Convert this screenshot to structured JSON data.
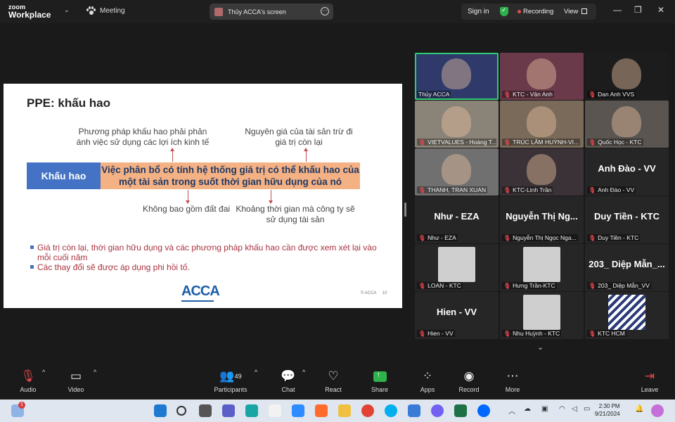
{
  "app": {
    "brand_top": "zoom",
    "brand_bottom": "Workplace",
    "meeting_label": "Meeting",
    "share_banner": "Thủy ACCA's screen",
    "signin": "Sign in",
    "recording": "Recording",
    "view": "View"
  },
  "slide": {
    "title": "PPE: khấu hao",
    "top_left": "Phương pháp khấu hao phải phản ánh việc sử dụng các lợi ích kinh tế",
    "top_right": "Nguyên giá của tài sản trừ đi giá trị còn lại",
    "term": "Khấu hao",
    "definition": "Việc phân bổ có tính hệ thống giá trị có thể khấu hao của một tài sản trong suốt thời gian hữu dụng của nó",
    "bottom_left": "Không bao gồm đất đai",
    "bottom_right": "Khoảng thời gian mà công ty sẽ sử dụng tài sản",
    "bullets": [
      "Giá trị còn lại, thời gian hữu dụng và các phương pháp khấu hao cần được xem xét lại vào mỗi cuối năm",
      "Các thay đổi sẽ được áp dụng phi hồi tố."
    ],
    "logo": "ACCA",
    "copyright": "© ACCA",
    "page": "10"
  },
  "gallery": [
    {
      "name": "Thủy ACCA",
      "big": "",
      "muted": false,
      "active": true,
      "bg": "#2f3a6b"
    },
    {
      "name": "KTC - Vân Anh",
      "big": "",
      "muted": true,
      "active": false,
      "bg": "#6b3a4a"
    },
    {
      "name": "Dan Anh VVS",
      "big": "",
      "muted": true,
      "active": false,
      "bg": "#1c1c1c"
    },
    {
      "name": "VIETVALUES - Hoàng T...",
      "big": "",
      "muted": true,
      "active": false,
      "bg": "#8a8478"
    },
    {
      "name": "TRÚC LÂM HUỲNH-VI...",
      "big": "",
      "muted": true,
      "active": false,
      "bg": "#7a6a5a"
    },
    {
      "name": "Quốc Học - KTC",
      "big": "",
      "muted": true,
      "active": false,
      "bg": "#5a5550"
    },
    {
      "name": "THANH, TRAN XUAN",
      "big": "",
      "muted": true,
      "active": false,
      "bg": "#707070"
    },
    {
      "name": "KTC-Linh Trần",
      "big": "",
      "muted": true,
      "active": false,
      "bg": "#3a3236"
    },
    {
      "name": "Anh Đào - VV",
      "big": "Anh Đào - VV",
      "muted": true,
      "active": false,
      "bg": "#262626"
    },
    {
      "name": "Như - EZA",
      "big": "Như - EZA",
      "muted": true,
      "active": false,
      "bg": "#262626"
    },
    {
      "name": "Nguyễn Thị Ngọc Nga...",
      "big": "Nguyễn Thị Ng...",
      "muted": true,
      "active": false,
      "bg": "#262626"
    },
    {
      "name": "Duy Tiền - KTC",
      "big": "Duy Tiền - KTC",
      "muted": true,
      "active": false,
      "bg": "#262626"
    },
    {
      "name": "LOAN - KTC",
      "big": "",
      "muted": true,
      "active": false,
      "bg": "#262626"
    },
    {
      "name": "Hưng Trần-KTC",
      "big": "",
      "muted": true,
      "active": false,
      "bg": "#262626"
    },
    {
      "name": "203_ Diệp Mẫn_VV",
      "big": "203_ Diệp Mẫn_...",
      "muted": true,
      "active": false,
      "bg": "#262626"
    },
    {
      "name": "Hien - VV",
      "big": "Hien - VV",
      "muted": true,
      "active": false,
      "bg": "#262626"
    },
    {
      "name": "Nhu Huỳnh - KTC",
      "big": "",
      "muted": true,
      "active": false,
      "bg": "#262626"
    },
    {
      "name": "KTC HCM",
      "big": "",
      "muted": true,
      "active": false,
      "bg": "#262626"
    }
  ],
  "toolbar": {
    "audio": "Audio",
    "video": "Video",
    "participants": "Participants",
    "participants_count": "49",
    "chat": "Chat",
    "react": "React",
    "share": "Share",
    "apps": "Apps",
    "record": "Record",
    "more": "More",
    "leave": "Leave"
  },
  "taskbar": {
    "time": "2:30 PM",
    "date": "9/21/2024",
    "badge": "1"
  }
}
